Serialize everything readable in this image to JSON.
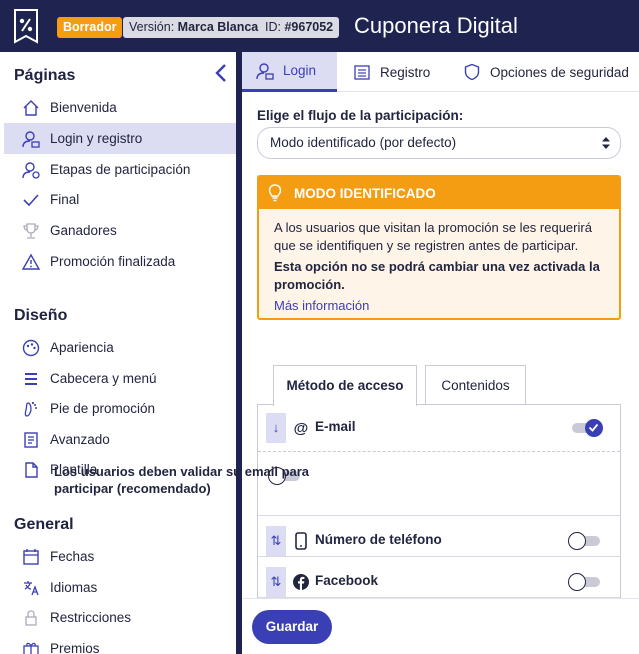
{
  "header": {
    "status_badge": "Borrador",
    "version_label": "Versión:",
    "version_value": "Marca Blanca",
    "id_label": "ID:",
    "id_value": "#967052",
    "app_title": "Cuponera Digital"
  },
  "sidebar": {
    "sections": [
      {
        "title": "Páginas"
      },
      {
        "title": "Diseño"
      },
      {
        "title": "General"
      }
    ],
    "items": [
      {
        "label": "Bienvenida",
        "icon": "home-icon"
      },
      {
        "label": "Login y registro",
        "icon": "user-lock-icon",
        "active": true
      },
      {
        "label": "Etapas de participación",
        "icon": "user-steps-icon"
      },
      {
        "label": "Final",
        "icon": "check-icon"
      },
      {
        "label": "Ganadores",
        "icon": "trophy-icon"
      },
      {
        "label": "Promoción finalizada",
        "icon": "warning-icon"
      },
      {
        "label": "Apariencia",
        "icon": "palette-icon"
      },
      {
        "label": "Cabecera y menú",
        "icon": "menu-icon"
      },
      {
        "label": "Pie de promoción",
        "icon": "footer-icon"
      },
      {
        "label": "Avanzado",
        "icon": "code-doc-icon"
      },
      {
        "label": "Plantilla",
        "icon": "template-icon"
      },
      {
        "label": "Fechas",
        "icon": "calendar-icon"
      },
      {
        "label": "Idiomas",
        "icon": "translate-icon"
      },
      {
        "label": "Restricciones",
        "icon": "lock-icon"
      },
      {
        "label": "Premios",
        "icon": "gift-icon"
      }
    ]
  },
  "tabs": [
    {
      "label": "Login",
      "active": true
    },
    {
      "label": "Registro"
    },
    {
      "label": "Opciones de seguridad"
    }
  ],
  "flow": {
    "label": "Elige el flujo de la participación:",
    "selected": "Modo identificado (por defecto)"
  },
  "alert": {
    "title": "MODO IDENTIFICADO",
    "text": "A los usuarios que visitan la promoción se les requerirá que se identifiquen y se registren antes de participar.",
    "warning": "Esta opción no se podrá cambiar una vez activada la promoción.",
    "link": "Más información"
  },
  "subtabs": [
    {
      "label": "Método de acceso",
      "active": true
    },
    {
      "label": "Contenidos"
    }
  ],
  "methods": {
    "email": {
      "label": "E-mail",
      "enabled": true
    },
    "validate": {
      "label": "Los usuarios deben validar su email para participar (recomendado)",
      "enabled": false
    },
    "phone": {
      "label": "Número de teléfono",
      "enabled": false
    },
    "facebook": {
      "label": "Facebook",
      "enabled": false
    }
  },
  "footer": {
    "save_label": "Guardar"
  },
  "colors": {
    "navy": "#1e2350",
    "accent": "#3b3fb5",
    "orange": "#f59d12",
    "active_bg": "#dcdcf3"
  }
}
